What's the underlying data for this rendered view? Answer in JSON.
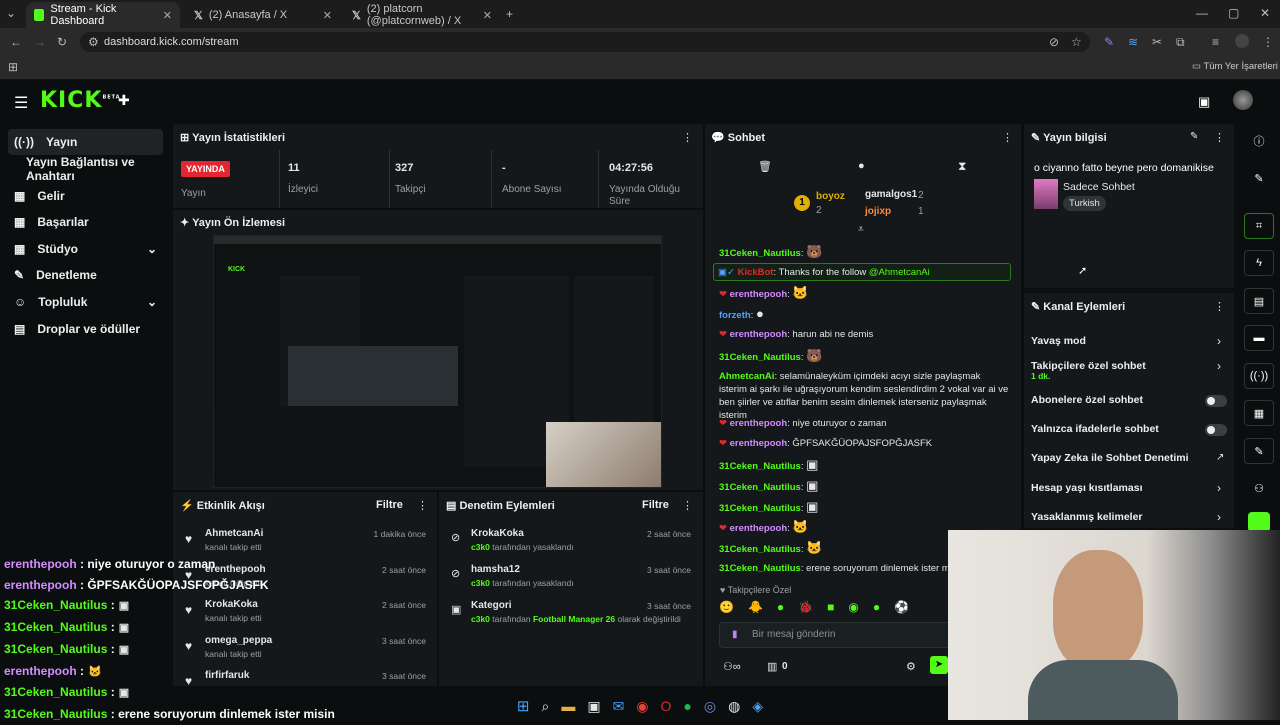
{
  "browser": {
    "tabs": [
      {
        "label": "Stream - Kick Dashboard",
        "active": true
      },
      {
        "label": "(2) Anasayfa / X",
        "active": false
      },
      {
        "label": "(2) platcorn (@platcornweb) / X",
        "active": false
      }
    ],
    "url": "dashboard.kick.com/stream",
    "bookmarks_label": "Tüm Yer İşaretleri"
  },
  "kick": {
    "logo": "KICK",
    "beta": "BETA"
  },
  "sidebar": {
    "items": [
      {
        "label": "Yayın",
        "icon": "broadcast-icon",
        "active": true
      },
      {
        "label": "Yayın Bağlantısı ve Anahtarı",
        "icon": "",
        "active": false
      },
      {
        "label": "Gelir",
        "icon": "money-icon",
        "active": false
      },
      {
        "label": "Başarılar",
        "icon": "trophy-icon",
        "active": false
      },
      {
        "label": "Stüdyo",
        "icon": "studio-icon",
        "active": false
      },
      {
        "label": "Denetleme",
        "icon": "wrench-icon",
        "active": false
      },
      {
        "label": "Topluluk",
        "icon": "people-icon",
        "active": false
      },
      {
        "label": "Droplar ve ödüller",
        "icon": "gift-icon",
        "active": false
      }
    ]
  },
  "stats": {
    "title": "Yayın İstatistikleri",
    "live_badge": "YAYINDA",
    "live_label": "Yayın",
    "viewers_value": "11",
    "viewers_label": "İzleyici",
    "followers_value": "327",
    "followers_label": "Takipçi",
    "subs_value": "-",
    "subs_label": "Abone Sayısı",
    "uptime_value": "04:27:56",
    "uptime_label": "Yayında Olduğu Süre"
  },
  "preview": {
    "title": "Yayın Ön İzlemesi"
  },
  "activity": {
    "title": "Etkinlik Akışı",
    "filter": "Filtre",
    "items": [
      {
        "name": "AhmetcanAi",
        "sub": "kanalı takip etti",
        "time": "1 dakika önce"
      },
      {
        "name": "erenthepooh",
        "sub": "kanalı takip etti",
        "time": "2 saat önce"
      },
      {
        "name": "KrokaKoka",
        "sub": "kanalı takip etti",
        "time": "2 saat önce"
      },
      {
        "name": "omega_peppa",
        "sub": "kanalı takip etti",
        "time": "3 saat önce"
      },
      {
        "name": "firfirfaruk",
        "sub": "",
        "time": "3 saat önce"
      }
    ]
  },
  "moderation": {
    "title": "Denetim Eylemleri",
    "filter": "Filtre",
    "items": [
      {
        "name": "KrokaKoka",
        "actor": "c3k0",
        "sub": "tarafından yasaklandı",
        "time": "2 saat önce"
      },
      {
        "name": "hamsha12",
        "actor": "c3k0",
        "sub": "tarafından yasaklandı",
        "time": "3 saat önce"
      },
      {
        "name": "Kategori",
        "actor": "c3k0",
        "sub": "tarafından",
        "target": "Football Manager 26",
        "sub2": "olarak değiştirildi",
        "time": "3 saat önce"
      }
    ]
  },
  "chat": {
    "title": "Sohbet",
    "leaders": [
      {
        "rank": "1",
        "name": "boyoz",
        "count": "2"
      },
      {
        "name": "gamalgos1",
        "count": "2"
      },
      {
        "name": "jojixp",
        "count": "1"
      }
    ],
    "messages": [
      {
        "user": "31Ceken_Nautilus",
        "text": ""
      },
      {
        "user": "KickBot",
        "text": "Thanks for the follow",
        "mention": "@AhmetcanAi"
      },
      {
        "user": "erenthepooh",
        "text": ""
      },
      {
        "user": "forzeth",
        "text": ""
      },
      {
        "user": "erenthepooh",
        "text": "harun abi ne demis"
      },
      {
        "user": "31Ceken_Nautilus",
        "text": ""
      },
      {
        "user": "AhmetcanAi",
        "text": "selamünaleyküm içimdeki acıyı sizle paylaşmak isterim ai şarkı ile uğraşıyorum kendim seslendirdim 2 vokal var ai ve ben şiirler ve atıflar benim sesim dinlemek isterseniz paylaşmak isterim"
      },
      {
        "user": "erenthepooh",
        "text": "niye oturuyor o zaman"
      },
      {
        "user": "erenthepooh",
        "text": "ĞPFSAKĞÜOPAJSFOPĞJASFK"
      },
      {
        "user": "31Ceken_Nautilus",
        "text": ""
      },
      {
        "user": "31Ceken_Nautilus",
        "text": ""
      },
      {
        "user": "31Ceken_Nautilus",
        "text": ""
      },
      {
        "user": "erenthepooh",
        "text": ""
      },
      {
        "user": "31Ceken_Nautilus",
        "text": ""
      },
      {
        "user": "31Ceken_Nautilus",
        "text": "erene soruyorum dinlemek ister misin"
      }
    ],
    "followers_only": "Takipçilere Özel",
    "input_placeholder": "Bir mesaj gönderin",
    "count": "0"
  },
  "stream_info": {
    "title": "Yayın bilgisi",
    "stream_title": "o ciyanno fatto beyne pero domanikise",
    "category": "Sadece Sohbet",
    "language": "Turkish"
  },
  "channel_actions": {
    "title": "Kanal Eylemleri",
    "items": [
      {
        "label": "Yavaş mod",
        "control": "chevron"
      },
      {
        "label": "Takipçilere özel sohbet",
        "sub": "1 dk.",
        "control": "chevron"
      },
      {
        "label": "Abonelere özel sohbet",
        "control": "toggle"
      },
      {
        "label": "Yalnızca ifadelerle sohbet",
        "control": "toggle"
      },
      {
        "label": "Yapay Zeka ile Sohbet Denetimi",
        "control": "external"
      },
      {
        "label": "Hesap yaşı kısıtlaması",
        "control": "chevron"
      },
      {
        "label": "Yasaklanmış kelimeler",
        "control": "chevron"
      }
    ]
  },
  "overlay_chat": [
    {
      "user": "erenthepooh",
      "text": ": niye oturuyor o zaman"
    },
    {
      "user": "erenthepooh",
      "text": ": ĞPFSAKĞÜOPAJSFOPĞJASFK"
    },
    {
      "user": "31Ceken_Nautilus",
      "text": ":"
    },
    {
      "user": "31Ceken_Nautilus",
      "text": ":"
    },
    {
      "user": "31Ceken_Nautilus",
      "text": ":"
    },
    {
      "user": "erenthepooh",
      "text": ":"
    },
    {
      "user": "31Ceken_Nautilus",
      "text": ":"
    },
    {
      "user": "31Ceken_Nautilus",
      "text": ": erene soruyorum dinlemek ister misin"
    }
  ]
}
